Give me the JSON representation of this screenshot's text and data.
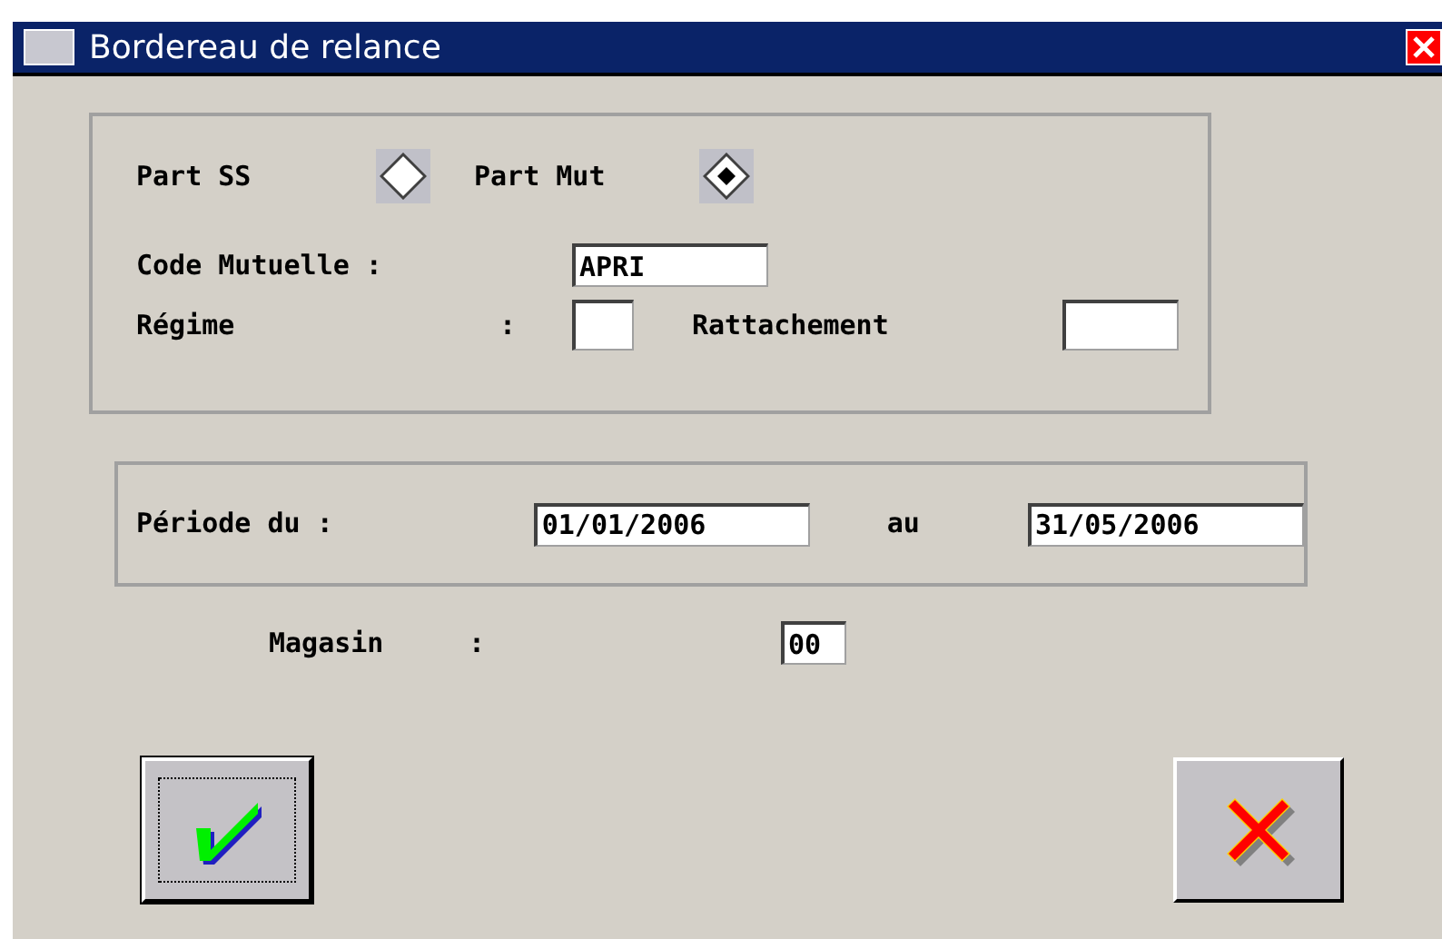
{
  "window": {
    "title": "Bordereau de relance"
  },
  "share": [
    {
      "label": "Part SS",
      "selected": false
    },
    {
      "label": "Part Mut",
      "selected": true
    }
  ],
  "code_mutuelle": {
    "label": "Code Mutuelle :",
    "value": "APRI"
  },
  "regime": {
    "label": "Régime",
    "colon": ":"
  },
  "rattachement": {
    "label": "Rattachement"
  },
  "period": {
    "label": "Période du :",
    "from": "01/01/2006",
    "to_label": "au",
    "to": "31/05/2006"
  },
  "magasin": {
    "label": "Magasin",
    "colon": ":",
    "value": "00"
  },
  "buttons": [
    {
      "kind": "ok",
      "focused": true
    },
    {
      "kind": "cancel",
      "focused": false
    }
  ]
}
